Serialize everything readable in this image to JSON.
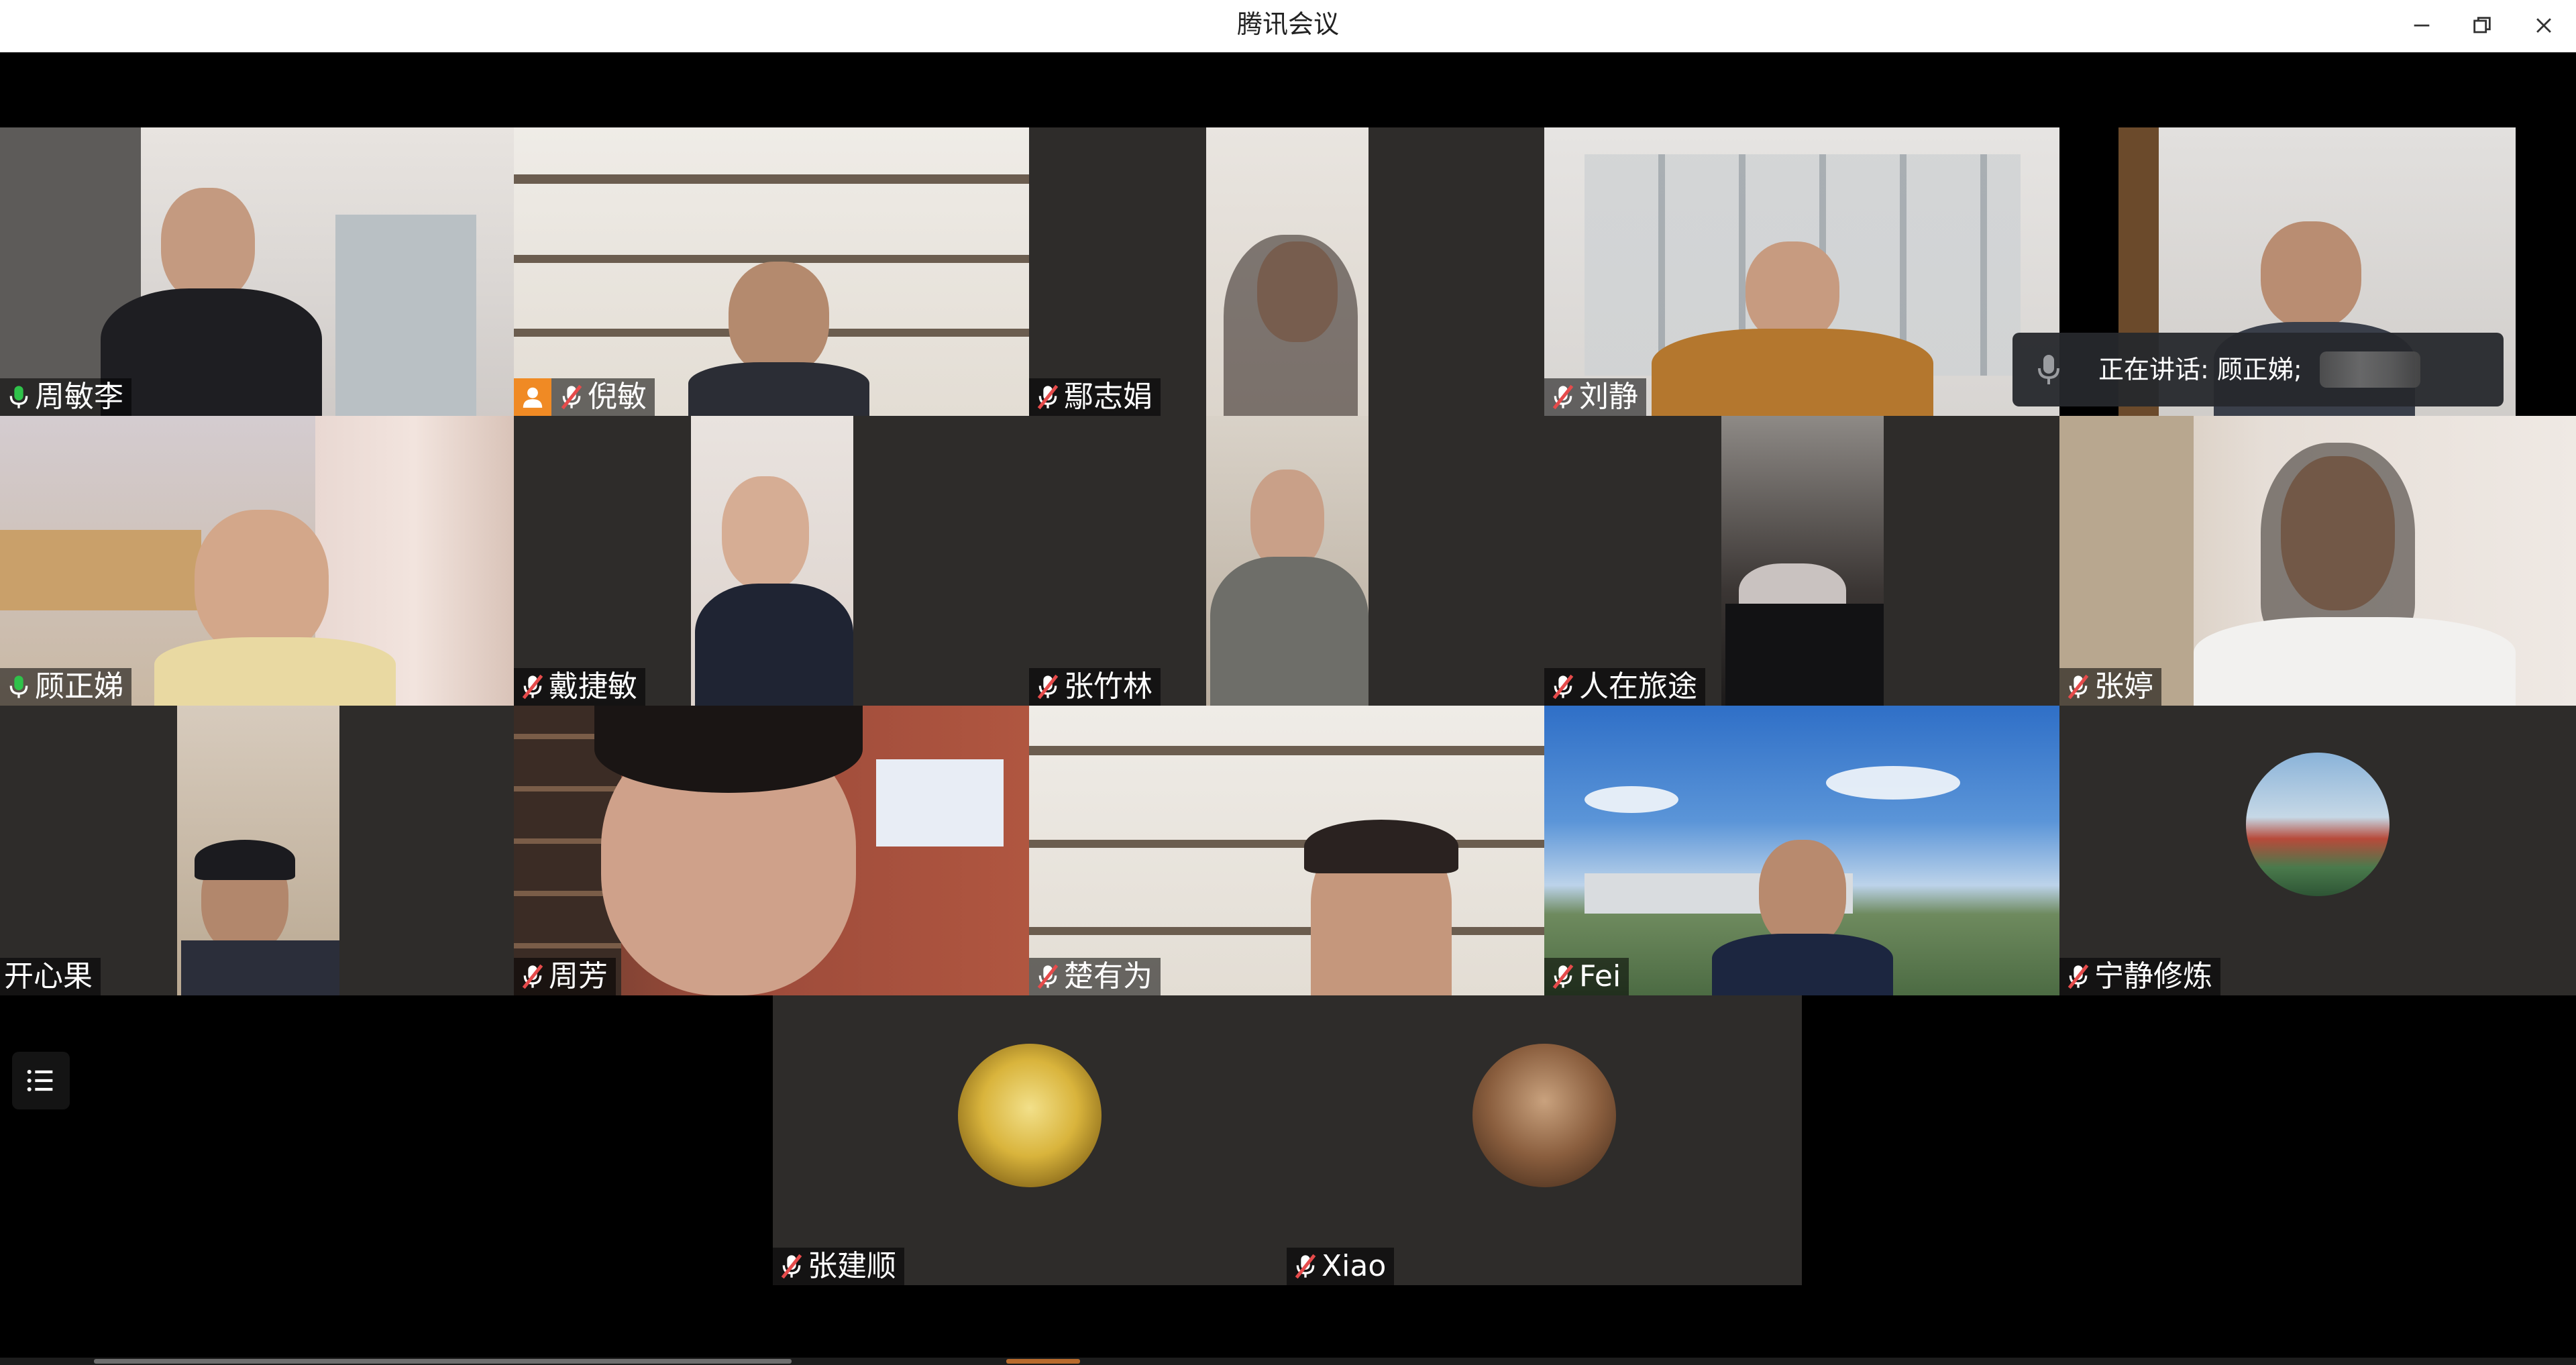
{
  "window": {
    "title": "腾讯会议"
  },
  "participants": [
    {
      "name": "周敏李",
      "mic": "on"
    },
    {
      "name": "倪敏",
      "mic": "muted",
      "host": true
    },
    {
      "name": "鄢志娟",
      "mic": "muted"
    },
    {
      "name": "刘静",
      "mic": "muted"
    },
    {
      "name": "",
      "mic": "none"
    },
    {
      "name": "顾正娣",
      "mic": "on"
    },
    {
      "name": "戴捷敏",
      "mic": "muted"
    },
    {
      "name": "张竹林",
      "mic": "muted"
    },
    {
      "name": "人在旅途",
      "mic": "muted"
    },
    {
      "name": "张婷",
      "mic": "muted"
    },
    {
      "name": "开心果",
      "mic": "none"
    },
    {
      "name": "周芳",
      "mic": "muted"
    },
    {
      "name": "楚有为",
      "mic": "muted"
    },
    {
      "name": "Fei",
      "mic": "muted"
    },
    {
      "name": "宁静修炼",
      "mic": "muted"
    },
    {
      "name": "张建顺",
      "mic": "muted"
    },
    {
      "name": "Xiao",
      "mic": "muted"
    }
  ],
  "speaking": {
    "text": "正在讲话: 顾正娣;"
  },
  "colors": {
    "tile_bg": "#2e2c2a",
    "host_badge": "#f08a24",
    "mic_on": "#2fc24a",
    "mic_muted": "#e64b4b"
  }
}
